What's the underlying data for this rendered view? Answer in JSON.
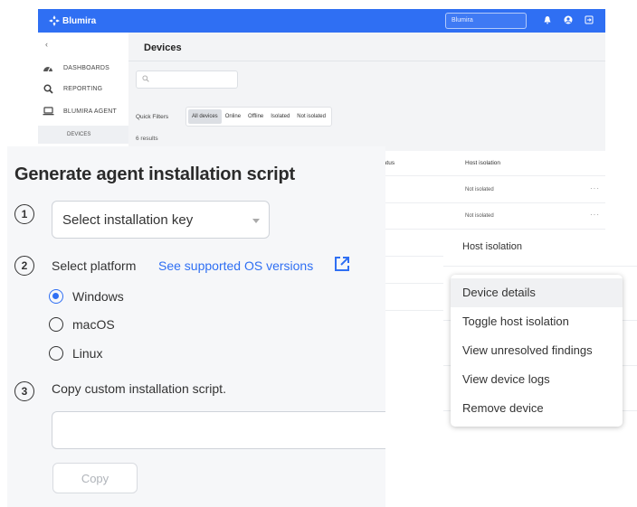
{
  "app": {
    "brand": "Blumira",
    "top_search_value": "Blumira",
    "colors": {
      "primary": "#2f6ff3",
      "content_bg": "#f3f4f6"
    }
  },
  "sidebar": {
    "collapse_glyph": "‹",
    "items": [
      {
        "label": "DASHBOARDS",
        "icon": "gauge-icon"
      },
      {
        "label": "REPORTING",
        "icon": "search-icon"
      },
      {
        "label": "BLUMIRA AGENT",
        "icon": "laptop-icon"
      }
    ],
    "sub_item": "DEVICES"
  },
  "main": {
    "title": "Devices",
    "quick_filters_label": "Quick Filters",
    "quick_filters": [
      "All devices",
      "Online",
      "Offline",
      "Isolated",
      "Not isolated"
    ],
    "active_filter": "All devices",
    "results": "6 results",
    "table": {
      "columns": [
        "Status",
        "Host isolation"
      ],
      "visible_status_fragment": "tatus",
      "rows": [
        {
          "host_isolation": "Not isolated",
          "menu": "···"
        },
        {
          "host_isolation": "Not isolated",
          "menu": "···"
        }
      ]
    }
  },
  "install": {
    "title": "Generate agent installation script",
    "steps": [
      "1",
      "2",
      "3"
    ],
    "key_select_value": "Select installation key",
    "platform_label": "Select platform",
    "os_link": "See supported OS versions",
    "platforms": [
      "Windows",
      "macOS",
      "Linux"
    ],
    "selected_platform": "Windows",
    "copy_label": "Copy custom installation script.",
    "script_value": "",
    "copy_button": "Copy"
  },
  "host_menu": {
    "header": "Host isolation",
    "items": [
      "Device details",
      "Toggle host isolation",
      "View unresolved findings",
      "View device logs",
      "Remove device"
    ],
    "hovered": "Device details"
  }
}
